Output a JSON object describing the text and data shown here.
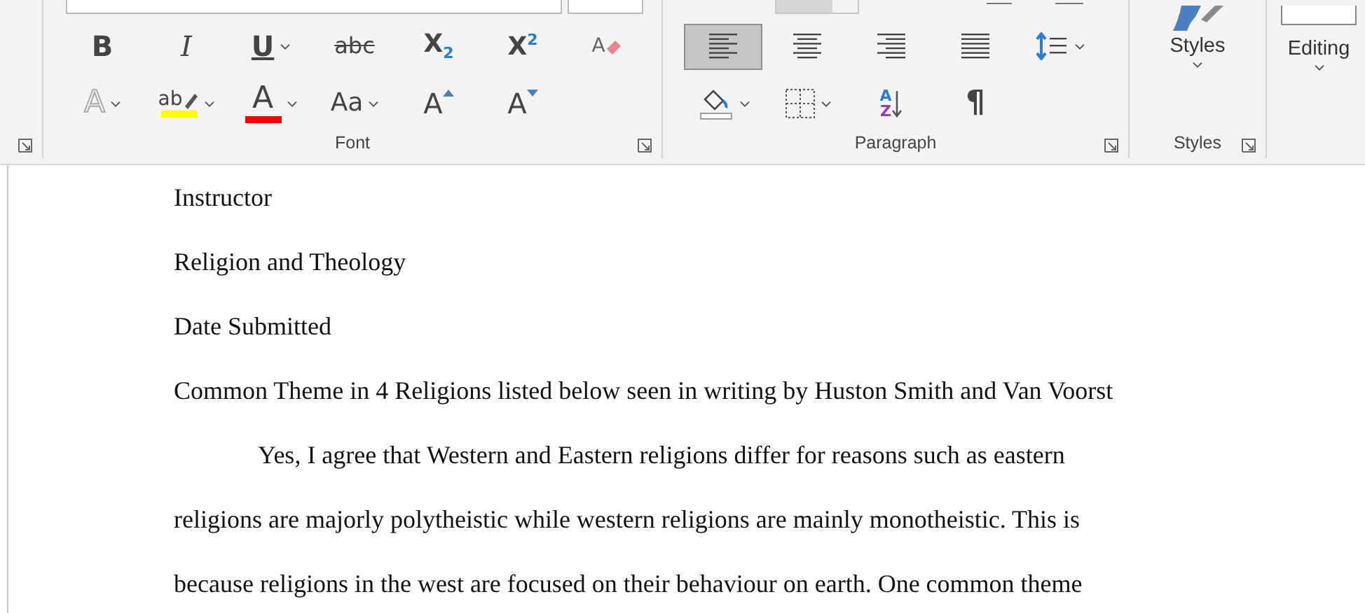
{
  "ribbon": {
    "left_group": {
      "launcher": true
    },
    "font": {
      "label": "Font",
      "launcher": true,
      "row1": [
        {
          "kind": "bold",
          "glyph": "B",
          "dropdown": false
        },
        {
          "kind": "italic",
          "glyph": "I",
          "dropdown": false
        },
        {
          "kind": "underline",
          "glyph": "U",
          "dropdown": true
        },
        {
          "kind": "strike",
          "glyph": "abc",
          "dropdown": false
        },
        {
          "kind": "subscript",
          "glyph": "X$_{2}$",
          "dropdown": false
        },
        {
          "kind": "superscript",
          "glyph": "X$^{2}$",
          "dropdown": false
        },
        {
          "kind": "clear",
          "glyph": "A",
          "dropdown": false
        }
      ],
      "row2": [
        {
          "kind": "effects",
          "glyph": "A",
          "dropdown": true
        },
        {
          "kind": "highlight",
          "glyph": "ab",
          "color": "#ffff00",
          "dropdown": true
        },
        {
          "kind": "fontcolor",
          "glyph": "A",
          "color": "#ff0000",
          "dropdown": true
        },
        {
          "kind": "case",
          "glyph": "Aa",
          "dropdown": true
        },
        {
          "kind": "grow",
          "glyph": "A",
          "dropdown": false
        },
        {
          "kind": "shrink",
          "glyph": "A",
          "dropdown": false
        }
      ]
    },
    "paragraph": {
      "label": "Paragraph",
      "launcher": true,
      "row1": [
        {
          "kind": "align-left",
          "selected": true,
          "dropdown": false
        },
        {
          "kind": "align-center",
          "selected": false,
          "dropdown": false
        },
        {
          "kind": "align-right",
          "selected": false,
          "dropdown": false
        },
        {
          "kind": "justify",
          "selected": false,
          "dropdown": false
        },
        {
          "kind": "spacing",
          "selected": false,
          "dropdown": true
        }
      ],
      "row2": [
        {
          "kind": "shading",
          "dropdown": true
        },
        {
          "kind": "borders",
          "dropdown": true
        },
        {
          "kind": "sort",
          "glyph": "A Z",
          "dropdown": false
        },
        {
          "kind": "pilcrow",
          "glyph": "¶",
          "dropdown": false
        }
      ]
    },
    "styles": {
      "label": "Styles",
      "button": "Styles",
      "launcher": true
    },
    "editing": {
      "button": "Editing"
    }
  },
  "document": {
    "lines": [
      {
        "text": "Instructor",
        "indent": false
      },
      {
        "text": "Religion and Theology",
        "indent": false
      },
      {
        "text": "Date Submitted",
        "indent": false
      },
      {
        "text": "Common Theme in 4 Religions listed below seen in writing by Huston Smith and Van Voorst",
        "indent": false
      },
      {
        "text": "Yes, I agree that Western and Eastern religions differ for reasons such as eastern",
        "indent": true
      },
      {
        "text": "religions are majorly polytheistic while western religions are mainly monotheistic. This is",
        "indent": false
      },
      {
        "text": "because religions in the west are focused on their behaviour on earth. One common theme",
        "indent": false
      }
    ]
  }
}
